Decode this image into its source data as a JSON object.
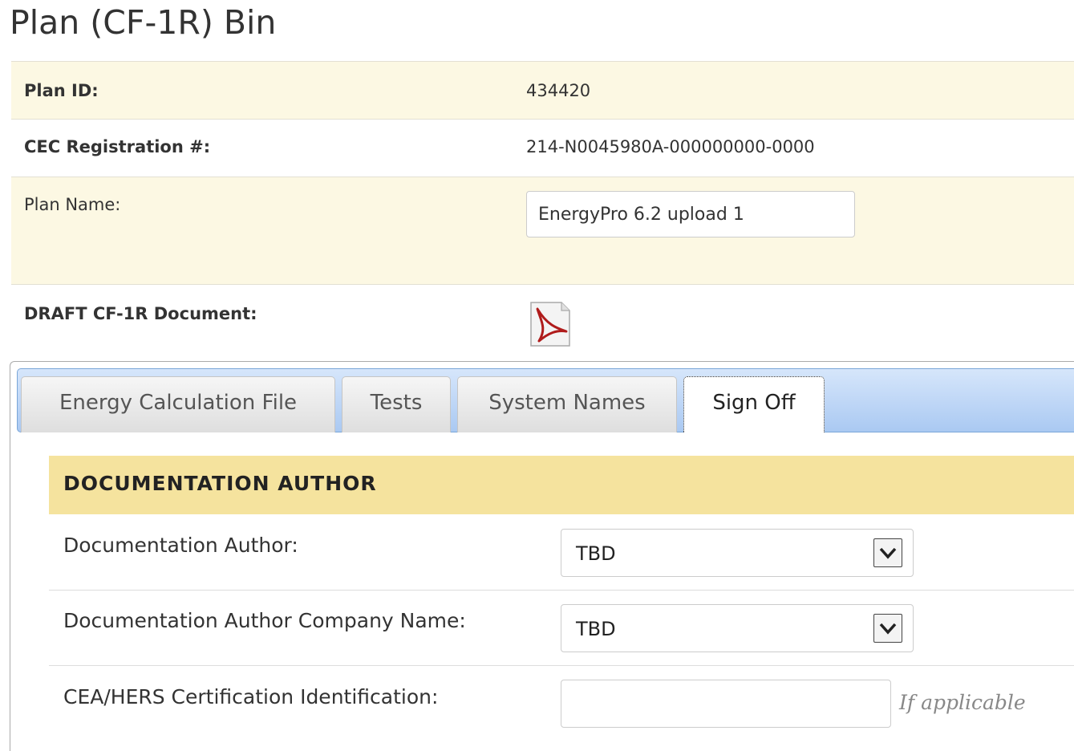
{
  "page": {
    "title": "Plan (CF-1R) Bin"
  },
  "info": {
    "plan_id_label": "Plan ID:",
    "plan_id_value": "434420",
    "cec_label": "CEC Registration #:",
    "cec_value": "214-N0045980A-000000000-0000",
    "plan_name_label": "Plan Name:",
    "plan_name_value": "EnergyPro 6.2 upload 1",
    "draft_label": "DRAFT CF-1R Document:",
    "draft_icon": "pdf-icon"
  },
  "tabs": [
    {
      "label": "Energy Calculation File",
      "active": false
    },
    {
      "label": "Tests",
      "active": false
    },
    {
      "label": "System Names",
      "active": false
    },
    {
      "label": "Sign Off",
      "active": true
    }
  ],
  "signoff": {
    "section_title": "DOCUMENTATION AUTHOR",
    "author_label": "Documentation Author:",
    "author_value": "TBD",
    "company_label": "Documentation Author Company Name:",
    "company_value": "TBD",
    "cert_label": "CEA/HERS Certification Identification:",
    "cert_value": "",
    "cert_hint": "If applicable"
  },
  "colors": {
    "info_row_highlight": "#fcf8e3",
    "section_header_bg": "#f5e39e",
    "tab_bar_blue": "#aac9f2",
    "pdf_red": "#b01c1c"
  }
}
